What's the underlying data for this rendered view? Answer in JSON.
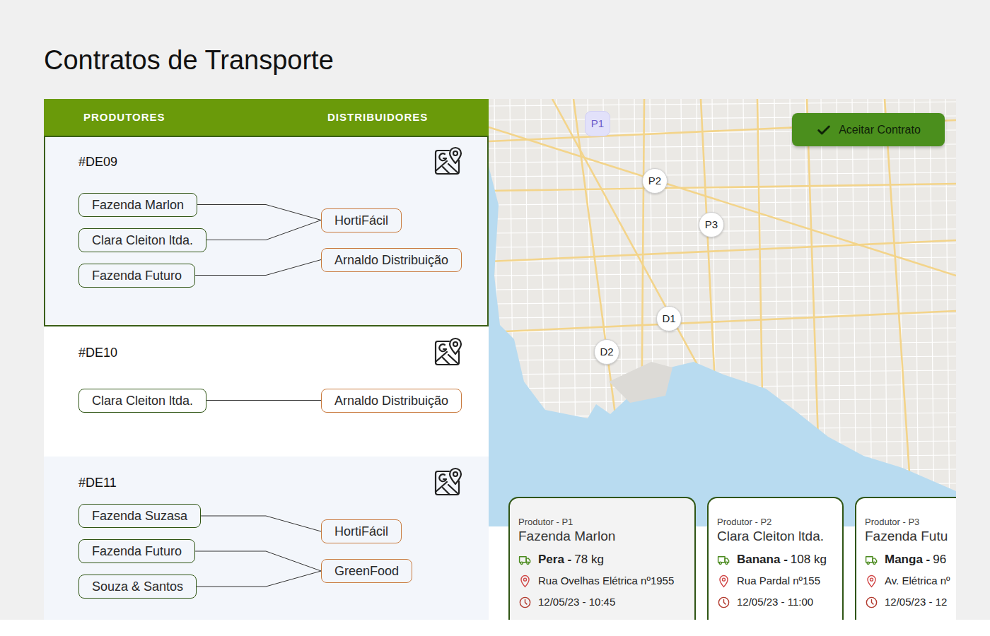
{
  "page": {
    "title": "Contratos de Transporte"
  },
  "header": {
    "producers": "PRODUTORES",
    "distributors": "DISTRIBUIDORES"
  },
  "contracts": [
    {
      "id": "#DE09",
      "selected": true,
      "producers": [
        "Fazenda Marlon",
        "Clara Cleiton ltda.",
        "Fazenda Futuro"
      ],
      "distributors": [
        "HortiFácil",
        "Arnaldo Distribuição"
      ],
      "links": [
        [
          0,
          0
        ],
        [
          1,
          0
        ],
        [
          2,
          1
        ]
      ]
    },
    {
      "id": "#DE10",
      "selected": false,
      "producers": [
        "Clara Cleiton ltda."
      ],
      "distributors": [
        "Arnaldo Distribuição"
      ],
      "links": [
        [
          0,
          0
        ]
      ]
    },
    {
      "id": "#DE11",
      "selected": false,
      "producers": [
        "Fazenda Suzasa",
        "Fazenda Futuro",
        "Souza & Santos"
      ],
      "distributors": [
        "HortiFácil",
        "GreenFood"
      ],
      "links": [
        [
          0,
          0
        ],
        [
          1,
          1
        ],
        [
          2,
          1
        ]
      ]
    }
  ],
  "map": {
    "pins": [
      {
        "label": "P1",
        "selected": true
      },
      {
        "label": "P2",
        "selected": false
      },
      {
        "label": "P3",
        "selected": false
      },
      {
        "label": "D1",
        "selected": false
      },
      {
        "label": "D2",
        "selected": false
      }
    ],
    "accept_button": "Aceitar Contrato"
  },
  "shipments": [
    {
      "caption": "Produtor - P1",
      "producer": "Fazenda Marlon",
      "product": "Pera -",
      "amount": "78 kg",
      "address": "Rua Ovelhas Elétrica nº1955",
      "time": "12/05/23 - 10:45",
      "selected": true
    },
    {
      "caption": "Produtor - P2",
      "producer": "Clara Cleiton ltda.",
      "product": "Banana -",
      "amount": "108 kg",
      "address": "Rua Pardal nº155",
      "time": "12/05/23 - 11:00",
      "selected": false
    },
    {
      "caption": "Produtor - P3",
      "producer": "Fazenda Futu",
      "product": "Manga -",
      "amount": "96",
      "address": "Av. Elétrica nº",
      "time": "12/05/23 - 12",
      "selected": false
    }
  ]
}
